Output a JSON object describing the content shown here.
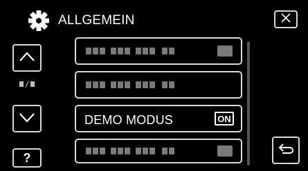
{
  "header": {
    "icon": "gear-icon",
    "title": "ALLGEMEIN",
    "close_icon": "close-icon"
  },
  "navigation": {
    "up_icon": "chevron-up-icon",
    "down_icon": "chevron-down-icon",
    "page_indicator_icon": "page-indicator-glyphs",
    "help_label": "?"
  },
  "menu": {
    "items": [
      {
        "label": "",
        "value": "",
        "label_icon": "garbled-text-glyphs",
        "value_icon": "garbled-value-glyph"
      },
      {
        "label": "",
        "value": "",
        "label_icon": "garbled-text-glyphs"
      },
      {
        "label": "DEMO MODUS",
        "value": "ON",
        "selected": true
      },
      {
        "label": "",
        "value": "",
        "label_icon": "garbled-text-glyphs",
        "value_icon": "garbled-value-glyph"
      }
    ]
  },
  "footer": {
    "back_icon": "return-arrow-icon"
  },
  "colors": {
    "background": "#000000",
    "border": "#d8d8d8",
    "text": "#ffffff",
    "placeholder_glyph": "#7a7a7a",
    "scrollbar": "#555555"
  }
}
